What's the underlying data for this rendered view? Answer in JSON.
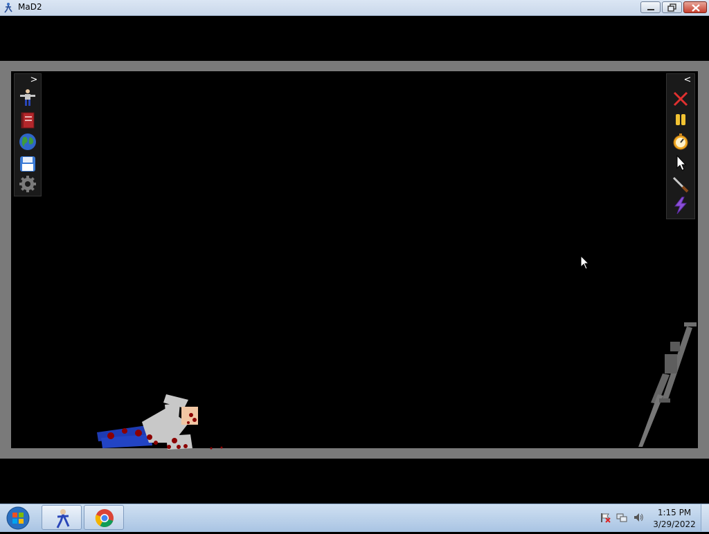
{
  "window": {
    "title": "MaD2"
  },
  "left_toolbar": {
    "toggle": ">",
    "tools": [
      "character-icon",
      "book-icon",
      "globe-icon",
      "save-icon",
      "settings-gear-icon"
    ]
  },
  "right_toolbar": {
    "toggle": "<",
    "tools": [
      "delete-x-icon",
      "pause-icon",
      "stopwatch-icon",
      "pointer-icon",
      "knife-icon",
      "lightning-icon"
    ]
  },
  "scene": {
    "objects": [
      "ragdoll-figure",
      "sniper-rifle"
    ],
    "colors": {
      "background": "#000000",
      "frame": "#7a7a7a",
      "blood": "#8b0000",
      "ragdoll_legs": "#1e3bb3",
      "ragdoll_body": "#c8c8c8"
    }
  },
  "taskbar": {
    "pinned": [
      "mad2-app-icon",
      "chrome-icon"
    ],
    "tray": [
      "action-center-flag-icon",
      "network-icon",
      "volume-icon"
    ],
    "time": "1:15 PM",
    "date": "3/29/2022"
  }
}
